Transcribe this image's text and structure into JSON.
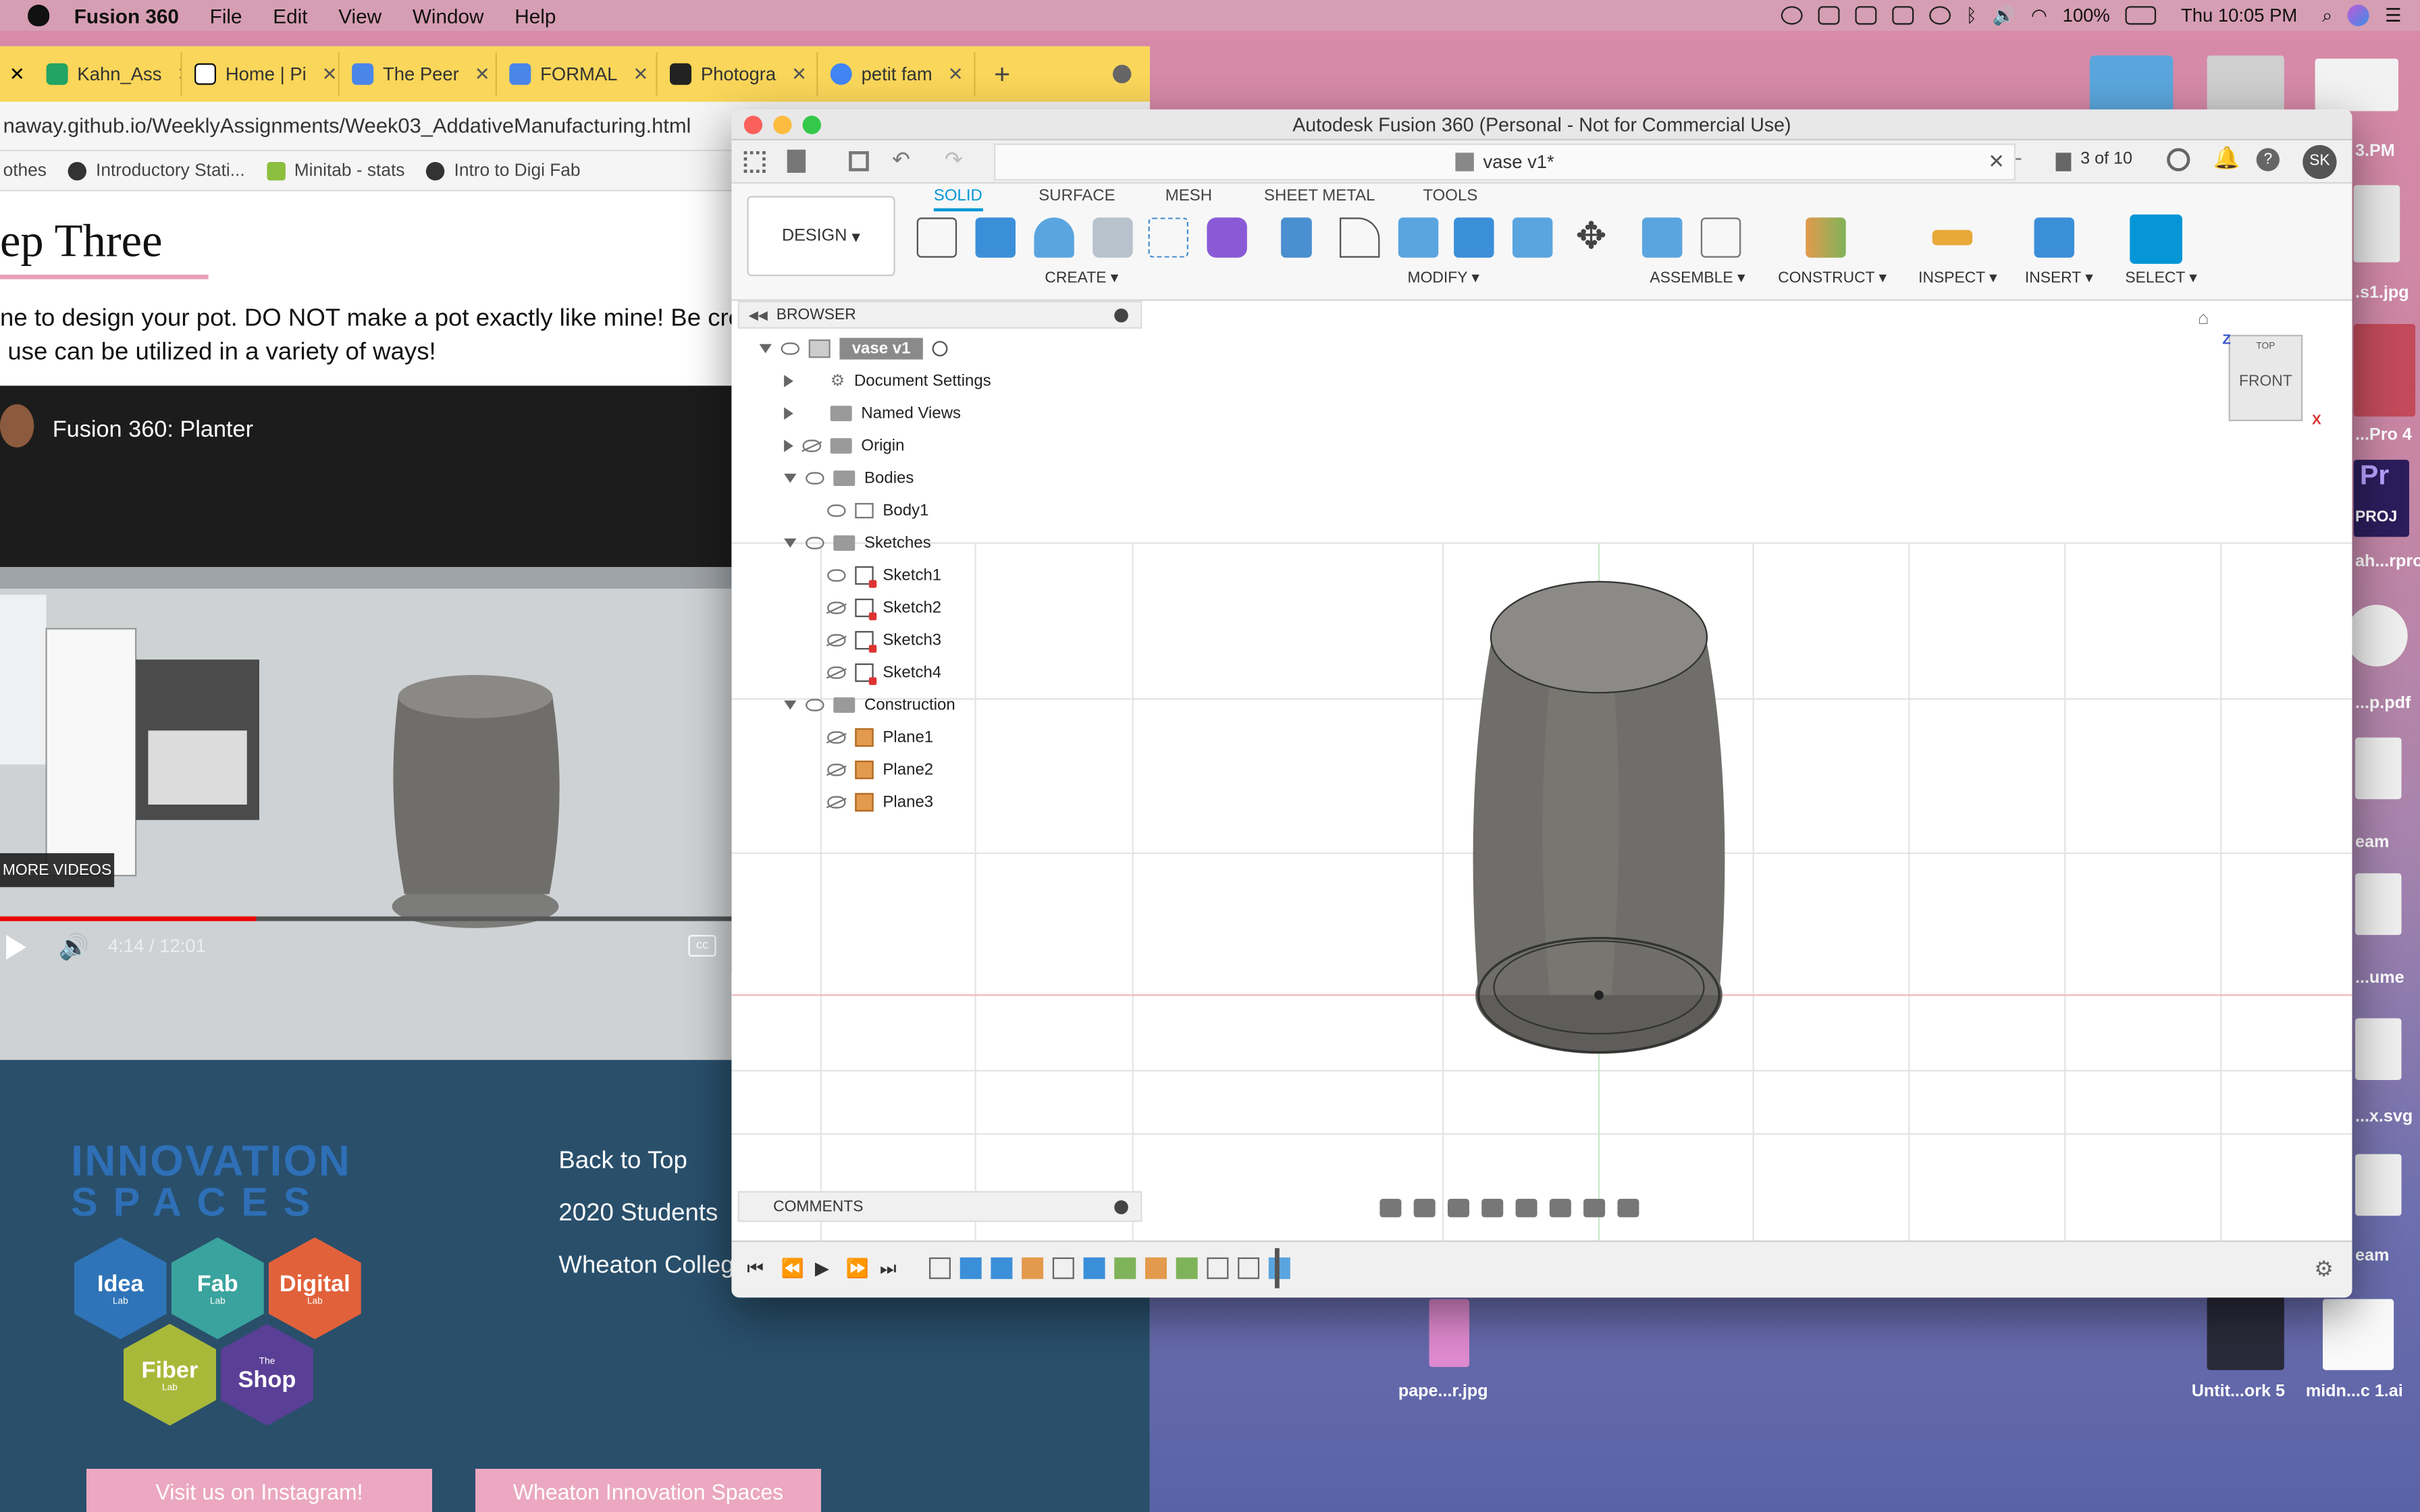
{
  "menubar": {
    "app_name": "Fusion 360",
    "items": [
      "File",
      "Edit",
      "View",
      "Window",
      "Help"
    ],
    "battery": "100%",
    "clock": "Thu 10:05 PM"
  },
  "browser": {
    "tabs": [
      {
        "label": "Kahn_Ass",
        "color": "#21a464"
      },
      {
        "label": "Home | Pi",
        "color": "#111111"
      },
      {
        "label": "The Peer",
        "color": "#4a86e8"
      },
      {
        "label": "FORMAL",
        "color": "#4a86e8"
      },
      {
        "label": "Photogra",
        "color": "#222222"
      },
      {
        "label": "petit fam",
        "color": "#4285f4"
      }
    ],
    "url": "naway.github.io/WeeklyAssignments/Week03_AddativeManufacturing.html",
    "bookmarks": [
      "othes",
      "Introductory Stati...",
      "Minitab - stats",
      "Intro to Digi Fab"
    ],
    "page": {
      "heading": "ep Three",
      "paragraph_1": "ne to design your pot. DO NOT make a pot exactly like mine! Be creat",
      "paragraph_2": "use can be utilized in a variety of ways!",
      "video_title": "Fusion 360: Planter",
      "more_videos": "MORE VIDEOS",
      "video_time": "4:14 / 12:01",
      "video_progress": 0.35
    },
    "footer": {
      "brand_line1": "INNOVATION",
      "brand_line2": "SPACES",
      "hexes": [
        {
          "title": "Idea",
          "sub": "Lab",
          "color": "#2f74b8"
        },
        {
          "title": "Fab",
          "sub": "Lab",
          "color": "#3aa39d"
        },
        {
          "title": "Digital",
          "sub": "Lab",
          "color": "#e1623a"
        },
        {
          "title": "Fiber",
          "sub": "Lab",
          "color": "#a8b93a"
        },
        {
          "title": "Shop",
          "sub": "The",
          "color": "#5a3f96"
        }
      ],
      "links": [
        "Back to Top",
        "2020 Students",
        "Wheaton Colleg"
      ],
      "buttons": [
        "Visit us on Instagram!",
        "Wheaton Innovation Spaces"
      ]
    }
  },
  "desktop": {
    "labels": [
      "3.PM",
      ".s1.jpg",
      "...Pro 4",
      "PROJ",
      "ah...rpro",
      "...p.pdf",
      "eam",
      "...ume",
      "...x.svg",
      "eam",
      "pape...r.jpg",
      "Untit...ork 5",
      "midn...c 1.ai"
    ]
  },
  "fusion": {
    "window_title": "Autodesk Fusion 360 (Personal - Not for Commercial Use)",
    "doc_tab": "vase v1*",
    "job_status": "3 of 10",
    "user_initials": "SK",
    "workspace": "DESIGN",
    "ribbon_tabs": [
      "SOLID",
      "SURFACE",
      "MESH",
      "SHEET METAL",
      "TOOLS"
    ],
    "ribbon_groups": [
      "CREATE",
      "MODIFY",
      "ASSEMBLE",
      "CONSTRUCT",
      "INSPECT",
      "INSERT",
      "SELECT"
    ],
    "browser_label": "BROWSER",
    "comments_label": "COMMENTS",
    "viewcube": {
      "top": "TOP",
      "front": "FRONT",
      "z": "Z",
      "x": "X"
    },
    "tree": [
      {
        "label": "vase v1",
        "indent": 0,
        "kind": "root"
      },
      {
        "label": "Document Settings",
        "indent": 1,
        "kind": "gear"
      },
      {
        "label": "Named Views",
        "indent": 1,
        "kind": "folder"
      },
      {
        "label": "Origin",
        "indent": 1,
        "kind": "folder"
      },
      {
        "label": "Bodies",
        "indent": 1,
        "kind": "folder"
      },
      {
        "label": "Body1",
        "indent": 2,
        "kind": "body"
      },
      {
        "label": "Sketches",
        "indent": 1,
        "kind": "folder"
      },
      {
        "label": "Sketch1",
        "indent": 2,
        "kind": "sketch"
      },
      {
        "label": "Sketch2",
        "indent": 2,
        "kind": "sketch"
      },
      {
        "label": "Sketch3",
        "indent": 2,
        "kind": "sketch"
      },
      {
        "label": "Sketch4",
        "indent": 2,
        "kind": "sketch"
      },
      {
        "label": "Construction",
        "indent": 1,
        "kind": "folder"
      },
      {
        "label": "Plane1",
        "indent": 2,
        "kind": "plane"
      },
      {
        "label": "Plane2",
        "indent": 2,
        "kind": "plane"
      },
      {
        "label": "Plane3",
        "indent": 2,
        "kind": "plane"
      }
    ]
  }
}
